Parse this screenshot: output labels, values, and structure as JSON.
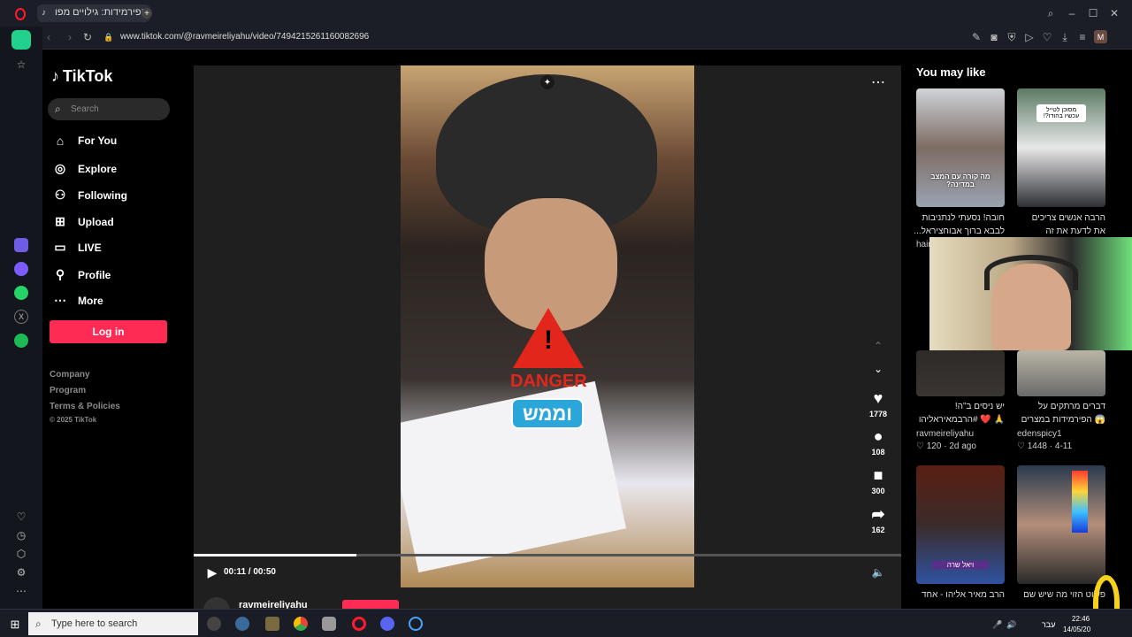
{
  "browser": {
    "tab_title": "סוד הפירמידות: גילויים מפו",
    "url": "www.tiktok.com/@ravmeireliyahu/video/7494215261160082696",
    "profile_initial": "M"
  },
  "tiktok": {
    "logo": "TikTok",
    "search_placeholder": "Search",
    "nav": [
      {
        "label": "For You",
        "icon": "home-icon"
      },
      {
        "label": "Explore",
        "icon": "compass-icon"
      },
      {
        "label": "Following",
        "icon": "user-following-icon"
      },
      {
        "label": "Upload",
        "icon": "upload-icon"
      },
      {
        "label": "LIVE",
        "icon": "live-icon"
      },
      {
        "label": "Profile",
        "icon": "profile-icon"
      },
      {
        "label": "More",
        "icon": "more-icon"
      }
    ],
    "login_label": "Log in",
    "footer": [
      "Company",
      "Program",
      "Terms & Policies",
      "© 2025 TikTok"
    ]
  },
  "player": {
    "time": "00:11 / 00:50",
    "progress": 0.23,
    "overlay_danger": "DANGER",
    "overlay_badge": "וממש",
    "author": "ravmeireliyahu",
    "actions": [
      {
        "icon": "heart-icon",
        "count": "1778"
      },
      {
        "icon": "comment-icon",
        "count": "108"
      },
      {
        "icon": "bookmark-icon",
        "count": "300"
      },
      {
        "icon": "share-icon",
        "count": "162"
      }
    ]
  },
  "recommend": {
    "title": "You may like",
    "items": [
      {
        "caption1": "חובה! נסעתי לנתניבות",
        "caption2": "לבבא ברוך אבוחציראל...",
        "author": "hair",
        "likes": "",
        "age": "",
        "thumb_text": "מה קורה עם המצב במדינה?"
      },
      {
        "caption1": "הרבה אנשים צריכים",
        "caption2": "את לדעת את זה",
        "author": "",
        "likes": "",
        "age": "",
        "thumb_text": "מסוכן לטייל עכשיו בהודו?!"
      },
      {
        "caption1": "יש ניסים ב\"ה!",
        "caption2": "🙏 ❤️ #הרבמאיראליהו",
        "author": "ravmeireliyahu",
        "likes": "120",
        "age": "2d ago",
        "thumb_text": ""
      },
      {
        "caption1": "דברים מרתקים על",
        "caption2": "😱 הפירמידות במצרים",
        "author": "edenspicy1",
        "likes": "1448",
        "age": "4-11",
        "thumb_text": ""
      },
      {
        "caption1": "הרב מאיר אליהו - אחד",
        "caption2": "",
        "author": "",
        "likes": "",
        "age": "",
        "thumb_text": "ויאל שרה"
      },
      {
        "caption1": "פשוט הזוי מה שיש שם",
        "caption2": "",
        "author": "",
        "likes": "",
        "age": "",
        "thumb_text": ""
      }
    ]
  },
  "taskbar": {
    "search_placeholder": "Type here to search",
    "lang": "עבר",
    "time": "22:46",
    "date": "14/05/20"
  }
}
